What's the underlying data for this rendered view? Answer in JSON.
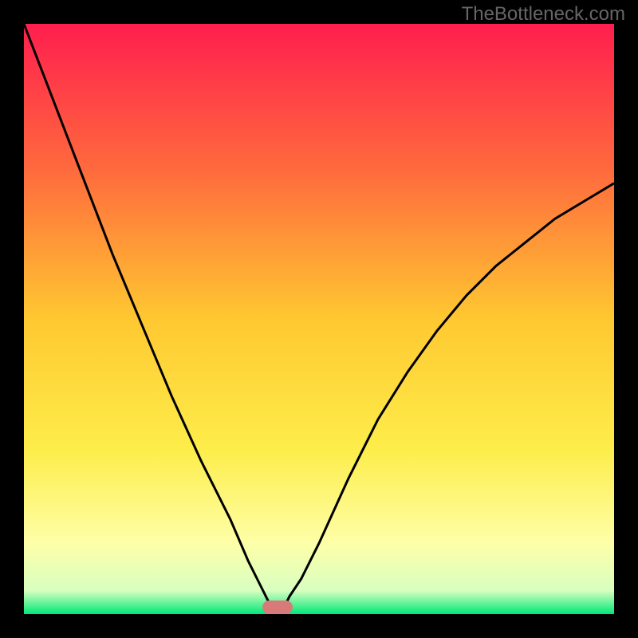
{
  "watermark": "TheBottleneck.com",
  "chart_data": {
    "type": "line",
    "title": "",
    "xlabel": "",
    "ylabel": "",
    "xlim": [
      0,
      100
    ],
    "ylim": [
      0,
      100
    ],
    "background": "gradient-red-yellow-green",
    "series": [
      {
        "name": "bottleneck-curve-left",
        "x": [
          0,
          5,
          10,
          15,
          20,
          25,
          30,
          35,
          38,
          40,
          41,
          42,
          43
        ],
        "values": [
          100,
          87,
          74,
          61,
          49,
          37,
          26,
          16,
          9,
          5,
          3,
          1,
          0
        ]
      },
      {
        "name": "bottleneck-curve-right",
        "x": [
          43,
          44,
          45,
          47,
          50,
          55,
          60,
          65,
          70,
          75,
          80,
          85,
          90,
          95,
          100
        ],
        "values": [
          0,
          1,
          3,
          6,
          12,
          23,
          33,
          41,
          48,
          54,
          59,
          63,
          67,
          70,
          73
        ]
      }
    ],
    "marker": {
      "x": 43,
      "y": 0,
      "color": "#d97a7a"
    },
    "gradient_stops": [
      {
        "offset": 0,
        "color": "#ff1e4e"
      },
      {
        "offset": 0.25,
        "color": "#ff6b3d"
      },
      {
        "offset": 0.5,
        "color": "#ffc831"
      },
      {
        "offset": 0.72,
        "color": "#fded4a"
      },
      {
        "offset": 0.88,
        "color": "#feffa8"
      },
      {
        "offset": 0.96,
        "color": "#d8ffc0"
      },
      {
        "offset": 1.0,
        "color": "#00e878"
      }
    ]
  }
}
